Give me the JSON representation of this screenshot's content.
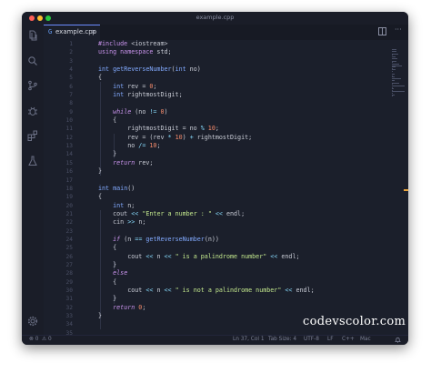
{
  "window": {
    "title": "example.cpp"
  },
  "tab": {
    "label": "example.cpp",
    "icon": "G",
    "close": "×"
  },
  "activity_bar": [
    {
      "name": "explorer-icon"
    },
    {
      "name": "search-icon"
    },
    {
      "name": "source-control-icon"
    },
    {
      "name": "debug-icon"
    },
    {
      "name": "extensions-icon"
    },
    {
      "name": "testing-icon"
    },
    {
      "name": "settings-gear-icon"
    }
  ],
  "code": {
    "line_numbers": [
      "1",
      "2",
      "3",
      "4",
      "5",
      "6",
      "7",
      "8",
      "9",
      "10",
      "11",
      "12",
      "13",
      "14",
      "15",
      "16",
      "17",
      "18",
      "19",
      "20",
      "21",
      "22",
      "23",
      "24",
      "25",
      "26",
      "27",
      "28",
      "29",
      "30",
      "31",
      "32",
      "33",
      "34",
      "35"
    ],
    "lines": [
      [
        [
          "pp",
          "#include "
        ],
        [
          "plain",
          "<iostream>"
        ]
      ],
      [
        [
          "kw",
          "using namespace "
        ],
        [
          "plain",
          "std;"
        ]
      ],
      [
        [
          "plain",
          ""
        ]
      ],
      [
        [
          "ty",
          "int "
        ],
        [
          "fn",
          "getReverseNumber"
        ],
        [
          "plain",
          "("
        ],
        [
          "ty",
          "int "
        ],
        [
          "plain",
          "no)"
        ]
      ],
      [
        [
          "plain",
          "{"
        ]
      ],
      [
        [
          "plain",
          "    "
        ],
        [
          "ty",
          "int "
        ],
        [
          "plain",
          "rev = "
        ],
        [
          "num",
          "0"
        ],
        [
          "plain",
          ";"
        ]
      ],
      [
        [
          "plain",
          "    "
        ],
        [
          "ty",
          "int "
        ],
        [
          "plain",
          "rightmostDigit;"
        ]
      ],
      [
        [
          "plain",
          ""
        ]
      ],
      [
        [
          "plain",
          "    "
        ],
        [
          "it",
          "while "
        ],
        [
          "plain",
          "(no "
        ],
        [
          "op",
          "!= "
        ],
        [
          "num",
          "0"
        ],
        [
          "plain",
          ")"
        ]
      ],
      [
        [
          "plain",
          "    {"
        ]
      ],
      [
        [
          "plain",
          "        rightmostDigit = no "
        ],
        [
          "op",
          "% "
        ],
        [
          "num",
          "10"
        ],
        [
          "plain",
          ";"
        ]
      ],
      [
        [
          "plain",
          "        rev = (rev "
        ],
        [
          "op",
          "* "
        ],
        [
          "num",
          "10"
        ],
        [
          "plain",
          ") "
        ],
        [
          "op",
          "+ "
        ],
        [
          "plain",
          "rightmostDigit;"
        ]
      ],
      [
        [
          "plain",
          "        no "
        ],
        [
          "op",
          "/= "
        ],
        [
          "num",
          "10"
        ],
        [
          "plain",
          ";"
        ]
      ],
      [
        [
          "plain",
          "    }"
        ]
      ],
      [
        [
          "plain",
          "    "
        ],
        [
          "it",
          "return "
        ],
        [
          "plain",
          "rev;"
        ]
      ],
      [
        [
          "plain",
          "}"
        ]
      ],
      [
        [
          "plain",
          ""
        ]
      ],
      [
        [
          "ty",
          "int "
        ],
        [
          "fn",
          "main"
        ],
        [
          "plain",
          "()"
        ]
      ],
      [
        [
          "plain",
          "{"
        ]
      ],
      [
        [
          "plain",
          "    "
        ],
        [
          "ty",
          "int "
        ],
        [
          "plain",
          "n;"
        ]
      ],
      [
        [
          "plain",
          "    cout "
        ],
        [
          "op",
          "<< "
        ],
        [
          "str",
          "\"Enter a number : \" "
        ],
        [
          "op",
          "<< "
        ],
        [
          "plain",
          "endl;"
        ]
      ],
      [
        [
          "plain",
          "    cin "
        ],
        [
          "op",
          ">> "
        ],
        [
          "plain",
          "n;"
        ]
      ],
      [
        [
          "plain",
          ""
        ]
      ],
      [
        [
          "plain",
          "    "
        ],
        [
          "it",
          "if "
        ],
        [
          "plain",
          "(n "
        ],
        [
          "op",
          "== "
        ],
        [
          "fn",
          "getReverseNumber"
        ],
        [
          "plain",
          "(n))"
        ]
      ],
      [
        [
          "plain",
          "    {"
        ]
      ],
      [
        [
          "plain",
          "        cout "
        ],
        [
          "op",
          "<< "
        ],
        [
          "plain",
          "n "
        ],
        [
          "op",
          "<< "
        ],
        [
          "str",
          "\" is a palindrome number\" "
        ],
        [
          "op",
          "<< "
        ],
        [
          "plain",
          "endl;"
        ]
      ],
      [
        [
          "plain",
          "    }"
        ]
      ],
      [
        [
          "plain",
          "    "
        ],
        [
          "it",
          "else"
        ]
      ],
      [
        [
          "plain",
          "    {"
        ]
      ],
      [
        [
          "plain",
          "        cout "
        ],
        [
          "op",
          "<< "
        ],
        [
          "plain",
          "n "
        ],
        [
          "op",
          "<< "
        ],
        [
          "str",
          "\" is not a palindrome number\" "
        ],
        [
          "op",
          "<< "
        ],
        [
          "plain",
          "endl;"
        ]
      ],
      [
        [
          "plain",
          "    }"
        ]
      ],
      [
        [
          "plain",
          "    "
        ],
        [
          "it",
          "return "
        ],
        [
          "num",
          "0"
        ],
        [
          "plain",
          ";"
        ]
      ],
      [
        [
          "plain",
          "}"
        ]
      ],
      [
        [
          "plain",
          ""
        ]
      ],
      [
        [
          "plain",
          ""
        ]
      ]
    ]
  },
  "status_bar": {
    "errors": "⊗ 0",
    "warnings": "⚠ 0",
    "position": "Ln 37, Col 1",
    "tab_size": "Tab Size: 4",
    "encoding": "UTF-8",
    "eol": "LF",
    "language": "C++",
    "platform": "Mac",
    "bell_icon": "bell-icon"
  },
  "watermark": {
    "text": "codevscolor.com"
  },
  "colors": {
    "editor_bg": "#1b1f2b",
    "keyword": "#c792ea",
    "type": "#82aaff",
    "string": "#c3e88d",
    "number": "#f78c6c",
    "operator": "#89ddff"
  }
}
